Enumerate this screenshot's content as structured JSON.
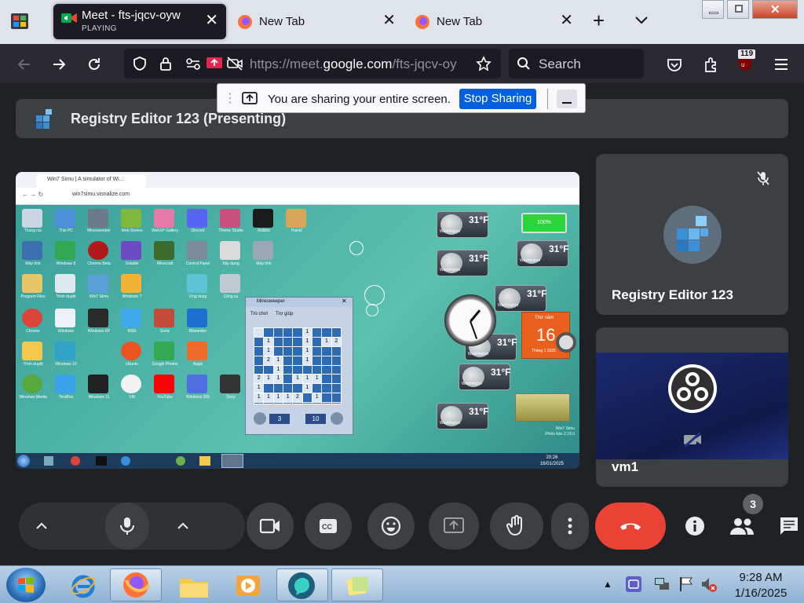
{
  "browser": {
    "tabs": [
      {
        "title": "Meet - fts-jqcv-oyw",
        "subtitle": "PLAYING",
        "active": true
      },
      {
        "title": "New Tab",
        "active": false
      },
      {
        "title": "New Tab",
        "active": false
      }
    ],
    "new_tab_symbol": "+",
    "url": {
      "prefix": "https://meet.",
      "domain": "google.com",
      "suffix": "/fts-jqcv-oy"
    },
    "search_placeholder": "Search",
    "extension_badge": "119"
  },
  "sharing_bar": {
    "message": "You are sharing your entire screen.",
    "stop_label": "Stop Sharing"
  },
  "meet": {
    "presenting_title": "Registry Editor 123 (Presenting)",
    "participants": [
      {
        "name": "Registry Editor 123",
        "muted": true
      },
      {
        "name": "vm1",
        "camera_off": true
      }
    ],
    "people_count": "3",
    "controls": [
      "expand-audio",
      "mic",
      "expand-video",
      "camera",
      "captions",
      "reactions",
      "present",
      "raise-hand",
      "more",
      "leave-call",
      "info",
      "people",
      "chat"
    ]
  },
  "shared_screen": {
    "tab_title": "Win7 Simu | A simulator of Wi...",
    "url": "win7simu.visnalize.com",
    "minesweeper": {
      "title": "Minesweeper",
      "menu_game": "Trò chơi",
      "menu_help": "Trợ giúp",
      "left_counter": "3",
      "right_counter": "10",
      "grid": [
        [
          "",
          "",
          "",
          "",
          "",
          "1",
          "",
          "",
          ""
        ],
        [
          "",
          "1",
          "",
          "",
          "",
          "1",
          "",
          "1",
          "2"
        ],
        [
          "",
          "1",
          "",
          "",
          "",
          "1",
          "",
          "",
          ""
        ],
        [
          "",
          "2",
          "1",
          "",
          "",
          "1",
          "",
          "",
          ""
        ],
        [
          "",
          "",
          "1",
          "",
          "",
          "",
          "",
          "",
          ""
        ],
        [
          "2",
          "1",
          "1",
          "",
          "1",
          "1",
          "1",
          "",
          ""
        ],
        [
          "1",
          "",
          "",
          "",
          "",
          "1",
          "",
          "",
          ""
        ],
        [
          "1",
          "1",
          "1",
          "1",
          "2",
          "",
          "1",
          "",
          ""
        ],
        [
          "",
          "",
          "",
          "",
          "",
          "",
          "",
          "",
          ""
        ]
      ]
    },
    "weather_temp": "31°F",
    "weather_location": "Washington",
    "calendar": {
      "day": "16",
      "weekday": "Thứ năm",
      "month": "Tháng 1 2025"
    },
    "battery": "100%",
    "watermark": [
      "Win7 Simu",
      "Phiên bản 2.19.0"
    ],
    "clock_time": "20:26",
    "clock_date": "16/01/2025",
    "desktop_icons": [
      "Thùng rác",
      "This PC",
      "Minesweeper",
      "Web Stories",
      "WebXP Gallery",
      "Discord",
      "Theme Studio",
      "Roblox",
      "PaintZ",
      "Máy tính",
      "Windows 8",
      "Chrome Beta",
      "Soluble",
      "Minecraft",
      "Control Panel",
      "Xây dựng",
      "Máy tính",
      "Program Files",
      "Trình duyệt",
      "Win7 Simu",
      "Windows 7",
      "Ứng dụng",
      "Công cụ",
      "Chrome",
      "Windows",
      "Windows XP",
      "MSN",
      "Sonic",
      "Bitwarden",
      "Trình duyệt",
      "Windows 10",
      "Ubuntu",
      "Google Photos",
      "Aegis",
      "Windows Media",
      "TeraBox",
      "Windows 11",
      "VM",
      "YouTube",
      "Windows 365",
      "Sony"
    ]
  },
  "taskbar": {
    "time": "9:28 AM",
    "date": "1/16/2025"
  },
  "colors": {
    "meet_bg": "#202124",
    "tile_bg": "#3c4043",
    "end_call": "#ea4335",
    "stop_sharing": "#0060df"
  }
}
